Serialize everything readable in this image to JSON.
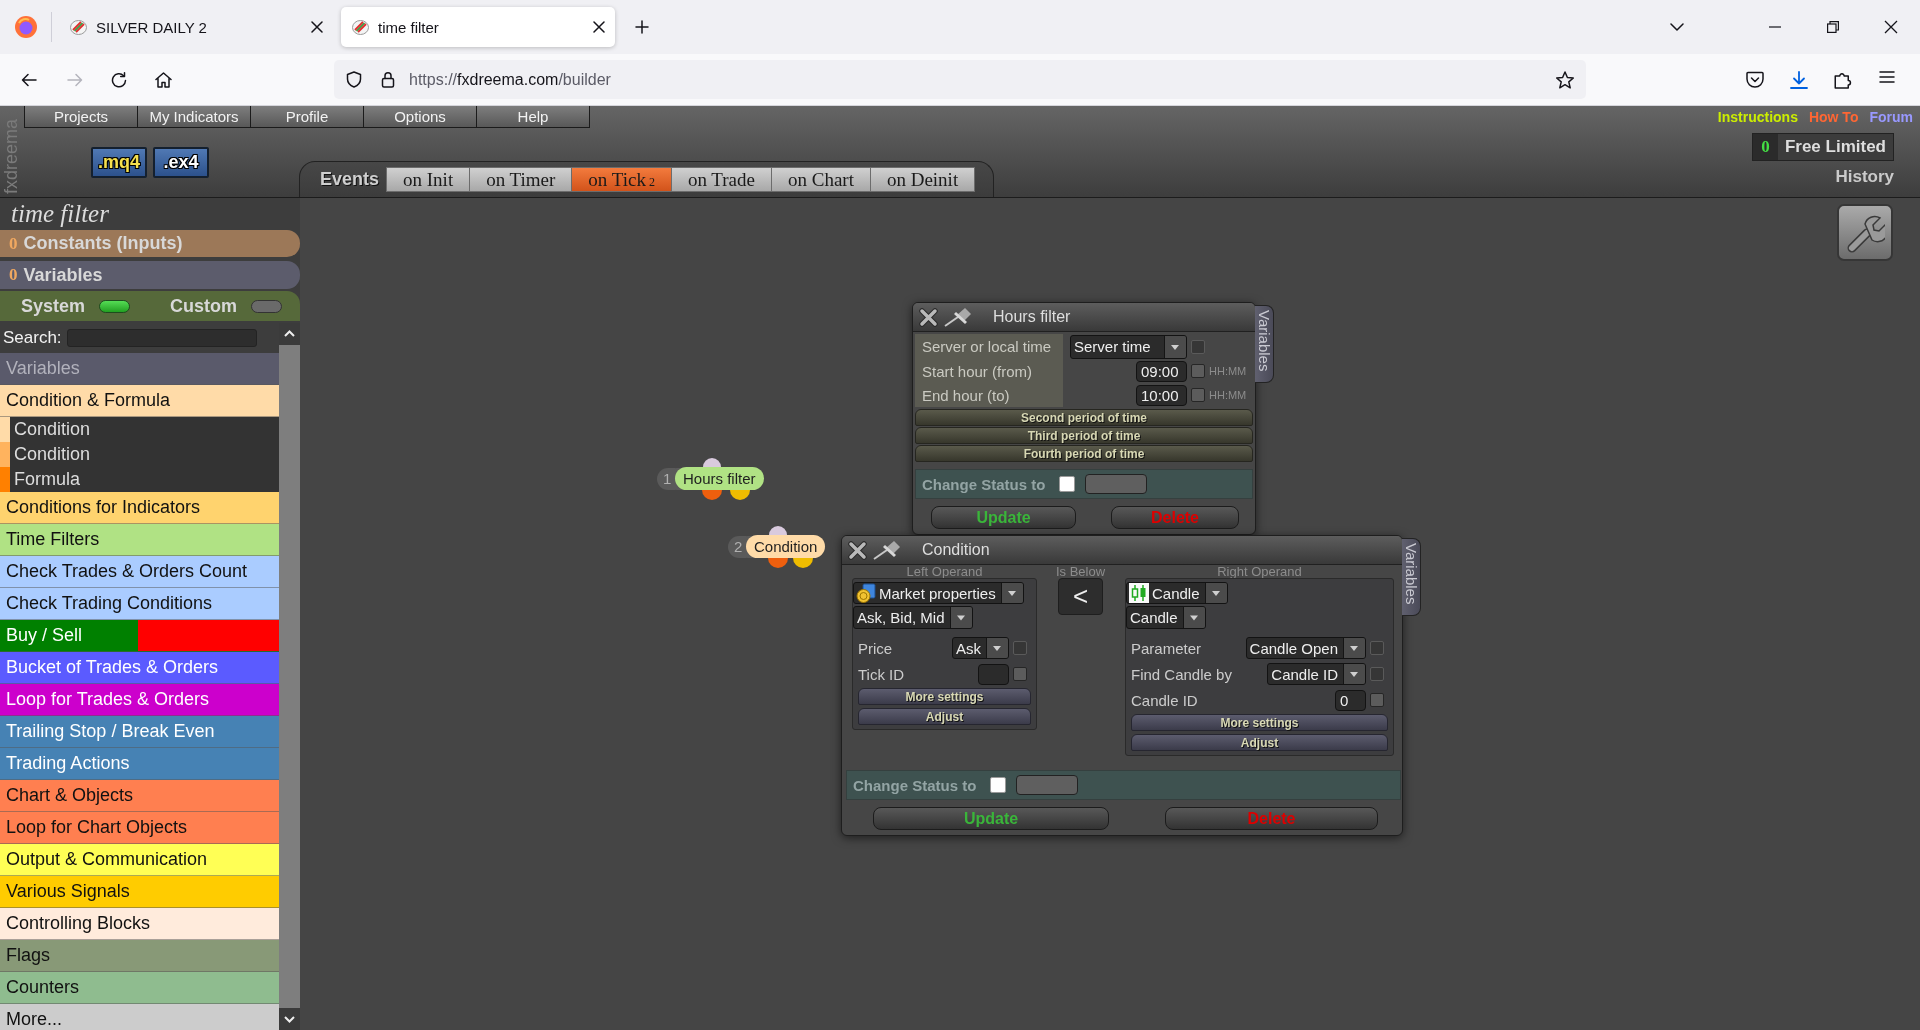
{
  "browser": {
    "tabs": [
      {
        "title": "SILVER DAILY 2",
        "selected": false
      },
      {
        "title": "time filter",
        "selected": true
      }
    ],
    "url": {
      "scheme": "https://",
      "host": "fxdreema.com",
      "path": "/builder"
    }
  },
  "header": {
    "brand": "fxdreema",
    "menu": [
      "Projects",
      "My Indicators",
      "Profile",
      "Options",
      "Help"
    ],
    "downloads": [
      {
        "label": ".mq4",
        "kind": "source"
      },
      {
        "label": ".ex4",
        "kind": "compiled"
      }
    ],
    "events": {
      "label": "Events",
      "tabs": [
        {
          "label": "on Init",
          "selected": false
        },
        {
          "label": "on Timer",
          "selected": false
        },
        {
          "label": "on Tick",
          "count": "2",
          "selected": true
        },
        {
          "label": "on Trade",
          "selected": false
        },
        {
          "label": "on Chart",
          "selected": false
        },
        {
          "label": "on Deinit",
          "selected": false
        }
      ]
    },
    "links": [
      {
        "label": "Instructions",
        "color": "#ccee00"
      },
      {
        "label": "How To",
        "color": "#ff6633"
      },
      {
        "label": "Forum",
        "color": "#9999ff"
      }
    ],
    "account": {
      "count": "0",
      "plan": "Free Limited"
    },
    "history": "History"
  },
  "sidebar": {
    "title": "time filter",
    "sections": [
      {
        "count": "0",
        "label": "Constants (Inputs)",
        "color": "#9c7858"
      },
      {
        "count": "0",
        "label": "Variables",
        "color": "#5c5c6c"
      }
    ],
    "toggles": [
      {
        "label": "System",
        "on": true
      },
      {
        "label": "Custom",
        "on": false
      }
    ],
    "search": {
      "label": "Search:"
    },
    "categories": [
      {
        "label": "Variables",
        "kind": "heading",
        "color": "#5a5a6b"
      },
      {
        "label": "Condition & Formula",
        "kind": "category",
        "color": "#ffdba8",
        "children": [
          {
            "label": "Condition",
            "color": "#ffdba8"
          },
          {
            "label": "Condition",
            "color": "#ffb35e"
          },
          {
            "label": "Formula",
            "color": "#ff8000"
          }
        ]
      },
      {
        "label": "Conditions for Indicators",
        "kind": "category",
        "color": "#ffd36e"
      },
      {
        "label": "Time Filters",
        "kind": "category",
        "color": "#b0e284"
      },
      {
        "label": "Check Trades & Orders Count",
        "kind": "category",
        "color": "#aaccff"
      },
      {
        "label": "Check Trading Conditions",
        "kind": "category",
        "color": "#aaccff"
      },
      {
        "label": "Buy / Sell",
        "kind": "category",
        "color": "#008000",
        "right_half": {
          "color": "#ff0000"
        }
      },
      {
        "label": "Bucket of Trades & Orders",
        "kind": "category",
        "color": "#5b5bff"
      },
      {
        "label": "Loop for Trades & Orders",
        "kind": "category",
        "color": "#cc00cc"
      },
      {
        "label": "Trailing Stop / Break Even",
        "kind": "category",
        "color": "#4682b4"
      },
      {
        "label": "Trading Actions",
        "kind": "category",
        "color": "#4682b4"
      },
      {
        "label": "Chart & Objects",
        "kind": "category",
        "color": "#ff7f50"
      },
      {
        "label": "Loop for Chart Objects",
        "kind": "category",
        "color": "#ff7f50"
      },
      {
        "label": "Output & Communication",
        "kind": "category",
        "color": "#ffff55"
      },
      {
        "label": "Various Signals",
        "kind": "category",
        "color": "#ffcc00"
      },
      {
        "label": "Controlling Blocks",
        "kind": "category",
        "color": "#ffebdc"
      },
      {
        "label": "Flags",
        "kind": "category",
        "color": "#889977"
      },
      {
        "label": "Counters",
        "kind": "category",
        "color": "#8fbc8f"
      },
      {
        "label": "More...",
        "kind": "category",
        "color": "#cccccc"
      }
    ]
  },
  "canvas": {
    "nodes": [
      {
        "number": "1",
        "label": "Hours filter",
        "color": "#b0e284"
      },
      {
        "number": "2",
        "label": "Condition",
        "color": "#ffdba8"
      }
    ],
    "panels": [
      {
        "kind": "hours_filter",
        "title": "Hours filter",
        "side_tab": "Variables",
        "fields": [
          {
            "kind": "select",
            "label": "Server or local time",
            "value": "Server time",
            "checkbox": {
              "checked": false,
              "disabled": true
            }
          },
          {
            "kind": "input",
            "label": "Start hour (from)",
            "value": "09:00",
            "format": "HH:MM",
            "checkbox": {
              "checked": false,
              "disabled": false
            }
          },
          {
            "kind": "input",
            "label": "End hour (to)",
            "value": "10:00",
            "format": "HH:MM",
            "checkbox": {
              "checked": false,
              "disabled": false
            }
          }
        ],
        "sections": [
          "Second period of time",
          "Third period of time",
          "Fourth period of time"
        ],
        "change_status": {
          "label": "Change Status to",
          "checked": false
        },
        "buttons": [
          {
            "label": "Update",
            "kind": "update"
          },
          {
            "label": "Delete",
            "kind": "delete"
          }
        ]
      },
      {
        "kind": "condition",
        "title": "Condition",
        "side_tab": "Variables",
        "operands": [
          {
            "heading": "Left Operand",
            "selects": [
              "Market properties",
              "Ask, Bid, Mid"
            ],
            "fields": [
              {
                "kind": "select",
                "label": "Price",
                "value": "Ask",
                "checkbox": {
                  "checked": false,
                  "disabled": true
                }
              },
              {
                "kind": "input",
                "label": "Tick ID",
                "checkbox": {
                  "checked": false,
                  "disabled": false
                }
              }
            ],
            "sections": [
              "More settings",
              "Adjust"
            ]
          },
          {
            "heading": "Right Operand",
            "selects": [
              "Candle",
              "Candle"
            ],
            "fields": [
              {
                "kind": "select",
                "label": "Parameter",
                "value": "Candle Open",
                "checkbox": {
                  "checked": false,
                  "disabled": true
                }
              },
              {
                "kind": "select",
                "label": "Find Candle by",
                "value": "Candle ID",
                "checkbox": {
                  "checked": false,
                  "disabled": true
                }
              },
              {
                "kind": "input",
                "label": "Candle ID",
                "value": "0",
                "checkbox": {
                  "checked": false,
                  "disabled": false
                }
              }
            ],
            "sections": [
              "More settings",
              "Adjust"
            ]
          }
        ],
        "operator": {
          "heading": "Is Below",
          "symbol": "<"
        },
        "change_status": {
          "label": "Change Status to",
          "checked": false
        },
        "buttons": [
          {
            "label": "Update",
            "kind": "update"
          },
          {
            "label": "Delete",
            "kind": "delete"
          }
        ]
      }
    ]
  }
}
